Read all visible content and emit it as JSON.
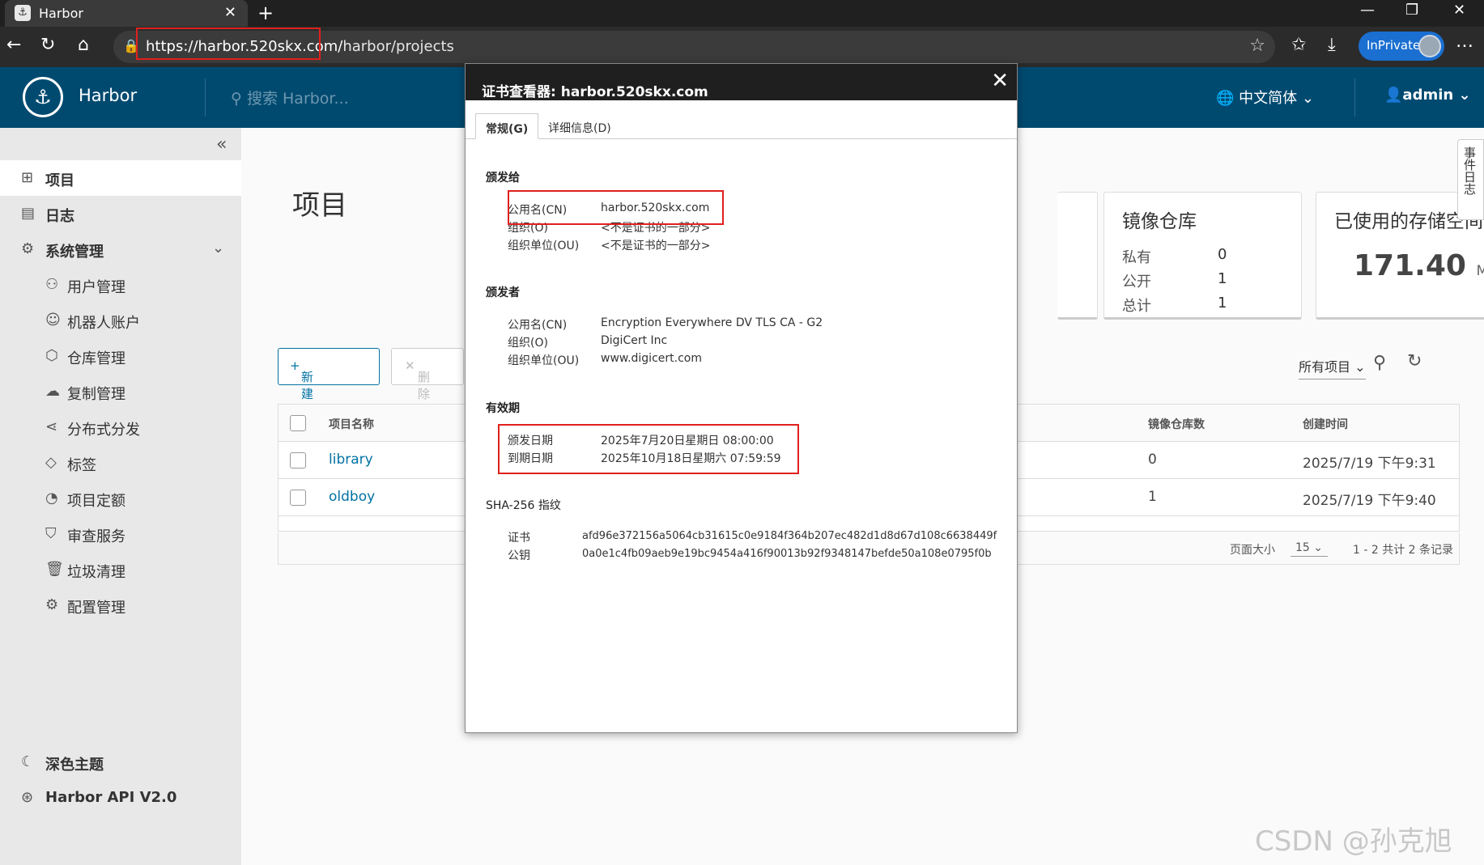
{
  "browser": {
    "tab_title": "Harbor",
    "url_host": "https://harbor.520skx.com/",
    "url_path": "harbor/projects",
    "inprivate_label": "InPrivate"
  },
  "header": {
    "brand": "Harbor",
    "search_placeholder": "搜索 Harbor...",
    "language": "中文简体",
    "user": "admin"
  },
  "sidebar": {
    "items": [
      {
        "label": "项目"
      },
      {
        "label": "日志"
      },
      {
        "label": "系统管理"
      }
    ],
    "sub_items": [
      {
        "label": "用户管理"
      },
      {
        "label": "机器人账户"
      },
      {
        "label": "仓库管理"
      },
      {
        "label": "复制管理"
      },
      {
        "label": "分布式分发"
      },
      {
        "label": "标签"
      },
      {
        "label": "项目定额"
      },
      {
        "label": "审查服务"
      },
      {
        "label": "垃圾清理"
      },
      {
        "label": "配置管理"
      }
    ],
    "dark_theme": "深色主题",
    "api": "Harbor API V2.0"
  },
  "main": {
    "title": "项目",
    "repo_card": {
      "title": "镜像仓库",
      "private_label": "私有",
      "private_value": "0",
      "public_label": "公开",
      "public_value": "1",
      "total_label": "总计",
      "total_value": "1"
    },
    "storage_card": {
      "title": "已使用的存储空间",
      "value": "171.40",
      "unit": "MiB"
    },
    "new_project_button": "新建项目",
    "delete_button": "删除",
    "filter": "所有项目",
    "columns": {
      "name": "项目名称",
      "repo_count": "镜像仓库数",
      "created": "创建时间"
    },
    "rows": [
      {
        "name": "library",
        "repo_count": "0",
        "created": "2025/7/19 下午9:31"
      },
      {
        "name": "oldboy",
        "repo_count": "1",
        "created": "2025/7/19 下午9:40"
      }
    ],
    "page_size_label": "页面大小",
    "page_size": "15",
    "pagination": "1 - 2 共计 2 条记录"
  },
  "side_tab": "事件日志",
  "watermark": "CSDN @孙克旭",
  "cert_dialog": {
    "title": "证书查看器: harbor.520skx.com",
    "tab_general": "常规(G)",
    "tab_details": "详细信息(D)",
    "issued_to": {
      "heading": "颁发给",
      "cn_label": "公用名(CN)",
      "cn_value": "harbor.520skx.com",
      "o_label": "组织(O)",
      "o_value": "<不是证书的一部分>",
      "ou_label": "组织单位(OU)",
      "ou_value": "<不是证书的一部分>"
    },
    "issued_by": {
      "heading": "颁发者",
      "cn_label": "公用名(CN)",
      "cn_value": "Encryption Everywhere DV TLS CA - G2",
      "o_label": "组织(O)",
      "o_value": "DigiCert Inc",
      "ou_label": "组织单位(OU)",
      "ou_value": "www.digicert.com"
    },
    "validity": {
      "heading": "有效期",
      "from_label": "颁发日期",
      "from_value": "2025年7月20日星期日 08:00:00",
      "to_label": "到期日期",
      "to_value": "2025年10月18日星期六 07:59:59"
    },
    "fingerprints": {
      "heading": "SHA-256 指纹",
      "cert_label": "证书",
      "cert_value": "afd96e372156a5064cb31615c0e9184f364b207ec482d1d8d67d108c6638449f",
      "key_label": "公钥",
      "key_value": "0a0e1c4fb09aeb9e19bc9454a416f90013b92f9348147befde50a108e0795f0b"
    }
  }
}
